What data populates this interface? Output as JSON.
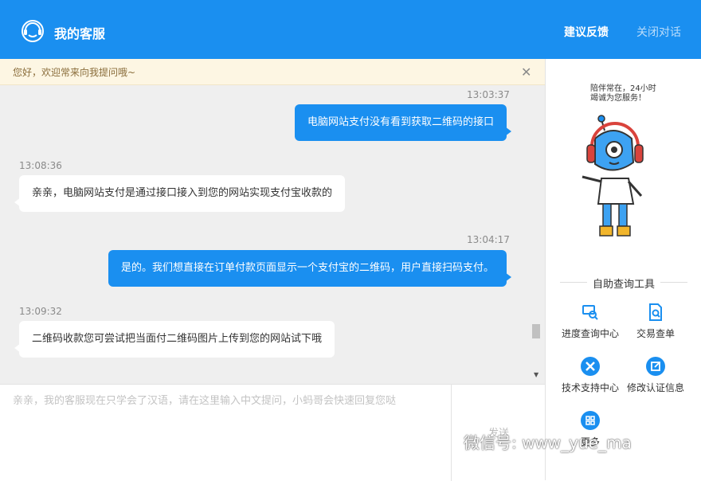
{
  "header": {
    "title": "我的客服",
    "feedback_label": "建议反馈",
    "close_label": "关闭对话"
  },
  "notice": {
    "text": "您好，欢迎常来向我提问哦~"
  },
  "messages": [
    {
      "time": "13:03:37",
      "from": "user",
      "text": "电脑网站支付没有看到获取二维码的接口"
    },
    {
      "time": "13:08:36",
      "from": "agent",
      "text": "亲亲，电脑网站支付是通过接口接入到您的网站实现支付宝收款的"
    },
    {
      "time": "13:04:17",
      "from": "user",
      "text": "是的。我们想直接在订单付款页面显示一个支付宝的二维码，用户直接扫码支付。"
    },
    {
      "time": "13:09:32",
      "from": "agent",
      "text": "二维码收款您可尝试把当面付二维码图片上传到您的网站试下哦"
    }
  ],
  "input": {
    "placeholder": "亲亲，我的客服现在只学会了汉语，请在这里输入中文提问，小蚂哥会快速回复您哒"
  },
  "send_label": "发送",
  "side": {
    "slogan_line1": "陪伴常在，24小时",
    "slogan_line2": "竭诚为您服务！",
    "tools_title": "自助查询工具",
    "tools": [
      {
        "label": "进度查询中心",
        "icon": "progress-search-icon"
      },
      {
        "label": "交易查单",
        "icon": "document-search-icon"
      },
      {
        "label": "技术支持中心",
        "icon": "tools-icon"
      },
      {
        "label": "修改认证信息",
        "icon": "edit-icon"
      },
      {
        "label": "更多",
        "icon": "grid-icon"
      }
    ]
  },
  "watermark": "微信号: www_yue_ma",
  "colors": {
    "brand": "#1a8ff0",
    "chat_bg": "#efefef",
    "notice_bg": "#fdf6e3"
  }
}
